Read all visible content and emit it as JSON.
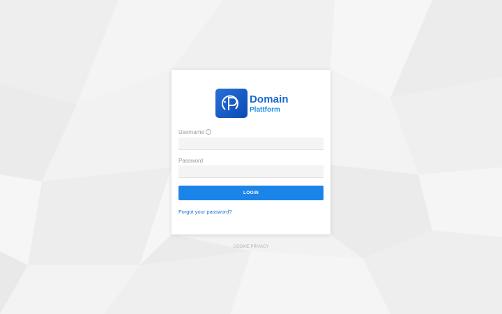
{
  "brand": {
    "name_line1": "Domain",
    "name_line2": "Plattform",
    "logo_icon": "p-monogram-icon",
    "primary_color": "#1368d1",
    "secondary_color": "#1a8ae6"
  },
  "login_form": {
    "username_label": "Username",
    "username_value": "",
    "password_label": "Password",
    "password_value": "",
    "login_button": "LOGIN",
    "forgot_password": "Forgot your password?",
    "button_color": "#1a84e8"
  },
  "footer": {
    "cookie_link": "COOKIE",
    "privacy_link": "PRIVACY"
  }
}
